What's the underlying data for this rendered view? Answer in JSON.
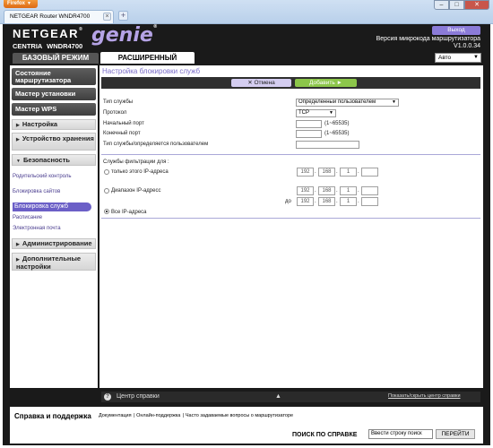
{
  "browser": {
    "app_button": "Firefox",
    "tab_title": "NETGEAR Router WNDR4700",
    "new_tab": "+",
    "close_tab": "×"
  },
  "header": {
    "brand": "NETGEAR",
    "genie": "genie",
    "centria": "CENTRIA",
    "model": "WNDR4700",
    "logout": "Выход",
    "firmware_label": "Версия микрокода маршрутизатора",
    "firmware_version": "V1.0.0.34",
    "tab_basic": "БАЗОВЫЙ РЕЖИМ",
    "tab_advanced": "РАСШИРЕННЫЙ",
    "language": "Авто"
  },
  "sidebar": {
    "status": "Состояние маршрутизатора",
    "wizard": "Мастер установки",
    "wps": "Мастер WPS",
    "setup": "Настройка",
    "storage": "Устройство хранения",
    "security": "Безопасность",
    "security_items": [
      "Родительский контроль",
      "Блокировка сайтов",
      "Блокировка служб",
      "Расписание",
      "Электронная почта"
    ],
    "admin": "Администрирование",
    "advanced": "Дополнительные настройки"
  },
  "main": {
    "title": "Настройка блокировки служб",
    "cancel": "Отмена",
    "add": "Добавить",
    "service_type_label": "Тип службы",
    "service_type_value": "Определенный пользователем",
    "protocol_label": "Протокол",
    "protocol_value": "TCP",
    "start_port_label": "Начальный порт",
    "start_port_hint": "(1~65535)",
    "end_port_label": "Конечный порт",
    "end_port_hint": "(1~65535)",
    "user_defined_label": "Тип службы/определяется пользователем",
    "filter_label": "Службы фильтрации для :",
    "only_ip_label": "только этого IP-адреса",
    "range_label": "Диапазон IP-адресс",
    "to_label": "до",
    "all_ip_label": "Все IP-адреса",
    "ip_oct1": "192",
    "ip_oct2": "168",
    "ip_oct3": "1"
  },
  "help": {
    "title": "Центр справки",
    "toggle": "Показать/скрыть центр справки"
  },
  "footer": {
    "title": "Справка и поддержка",
    "links": [
      "Документация",
      "Онлайн-поддержка",
      "Часто задаваемые вопросы о маршрутизаторе"
    ],
    "search_label": "ПОИСК ПО СПРАВКЕ",
    "search_placeholder": "Ввести строку поиск",
    "go": "ПЕРЕЙТИ"
  }
}
